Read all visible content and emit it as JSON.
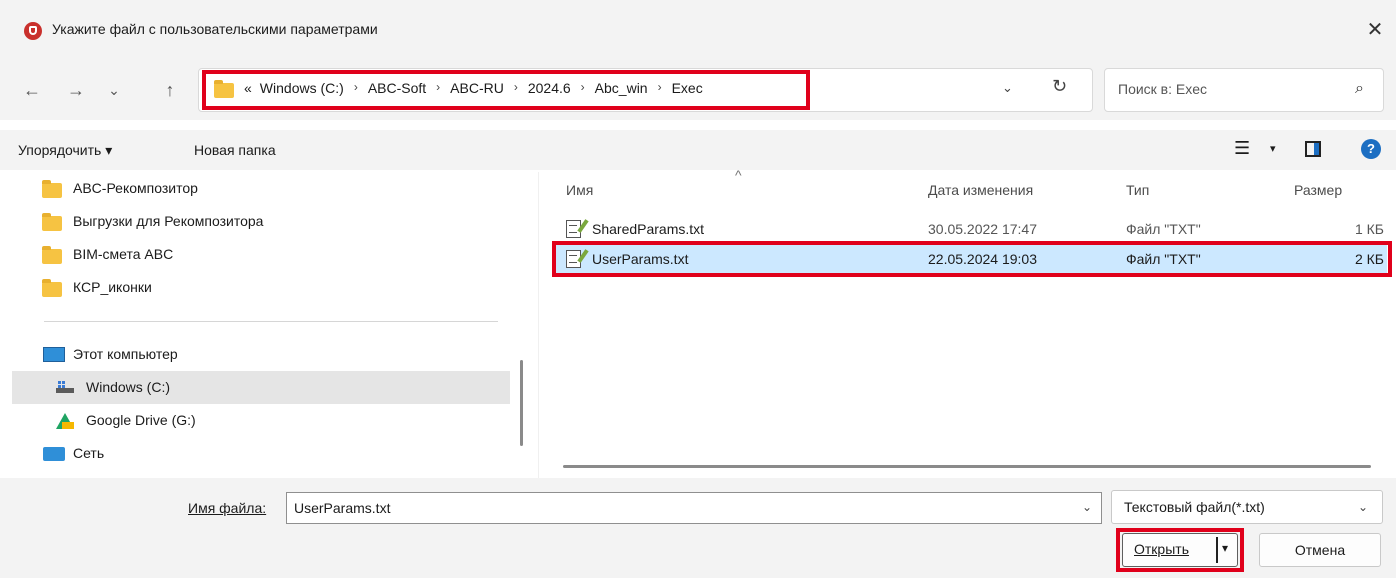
{
  "window": {
    "title": "Укажите файл с пользовательскими параметрами",
    "close_glyph": "✕"
  },
  "nav": {
    "back_glyph": "←",
    "forward_glyph": "→",
    "recent_glyph": "⌄",
    "up_glyph": "↑"
  },
  "address": {
    "overflow": "«",
    "crumbs": [
      "Windows (C:)",
      "ABC-Soft",
      "ABC-RU",
      "2024.6",
      "Abc_win",
      "Exec"
    ],
    "separator": "›",
    "dropdown_glyph": "⌄",
    "refresh_glyph": "↻"
  },
  "search": {
    "placeholder": "Поиск в: Exec",
    "icon_glyph": "⌕"
  },
  "toolbar": {
    "organize": "Упорядочить ▾",
    "new_folder": "Новая папка",
    "view_glyph": "☰",
    "view_caret": "▾",
    "help_glyph": "?"
  },
  "sidebar": {
    "items": [
      {
        "label": "ABC-Рекомпозитор"
      },
      {
        "label": "Выгрузки для Рекомпозитора"
      },
      {
        "label": "BIM-смета ABC"
      },
      {
        "label": "КСР_иконки"
      },
      {
        "label": "Этот компьютер"
      },
      {
        "label": "Windows (C:)"
      },
      {
        "label": "Google Drive (G:)"
      },
      {
        "label": "Сеть"
      }
    ]
  },
  "filelist": {
    "columns": [
      "Имя",
      "Дата изменения",
      "Тип",
      "Размер"
    ],
    "sort_glyph": "^",
    "rows": [
      {
        "name": "SharedParams.txt",
        "date": "30.05.2022 17:47",
        "type": "Файл \"TXT\"",
        "size": "1 КБ"
      },
      {
        "name": "UserParams.txt",
        "date": "22.05.2024 19:03",
        "type": "Файл \"TXT\"",
        "size": "2 КБ"
      }
    ]
  },
  "footer": {
    "filename_label": "Имя файла:",
    "filename_value": "UserParams.txt",
    "filetype_value": "Текстовый файл(*.txt)",
    "chev_glyph": "⌄",
    "open": "Открыть",
    "open_caret": "▾",
    "cancel": "Отмена"
  },
  "colors": {
    "highlight": "#e0001b",
    "selection": "#cce8ff",
    "folder": "#f6c342"
  }
}
